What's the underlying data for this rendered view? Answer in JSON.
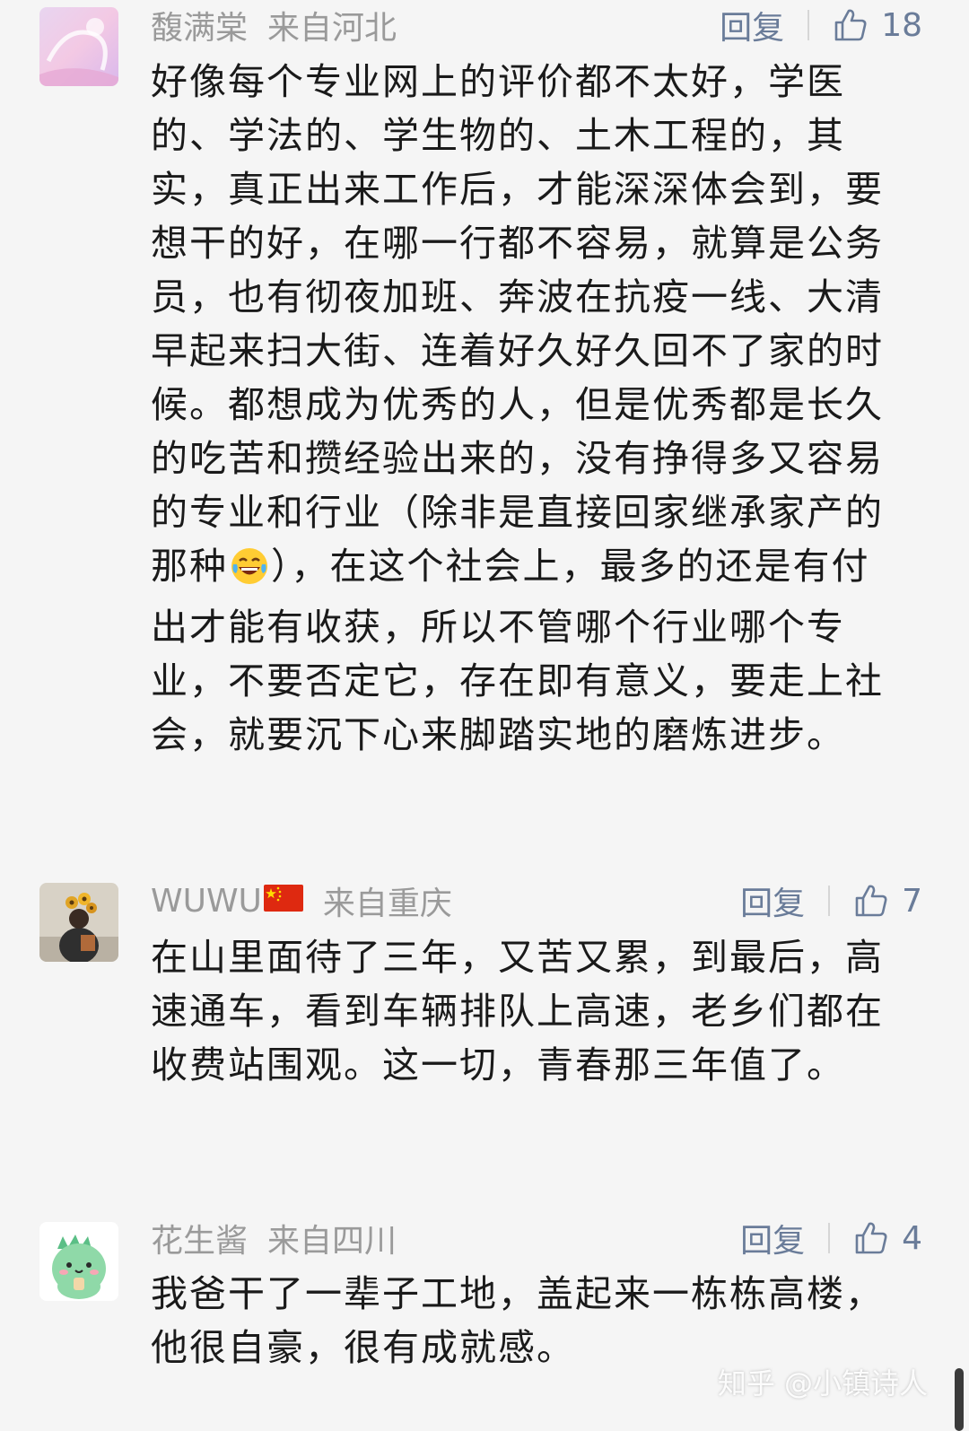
{
  "comments": [
    {
      "username": "馥满棠",
      "location": "来自河北",
      "reply_label": "回复",
      "likes": "18",
      "text_before_emoji": "好像每个专业网上的评价都不太好，学医的、学法的、学生物的、土木工程的，其实，真正出来工作后，才能深深体会到，要想干的好，在哪一行都不容易，就算是公务员，也有彻夜加班、奔波在抗疫一线、大清早起来扫大街、连着好久好久回不了家的时候。都想成为优秀的人，但是优秀都是长久的吃苦和攒经验出来的，没有挣得多又容易的专业和行业（除非是直接回家继承家产的那种",
      "emoji_icon": "laughing-tears-emoji",
      "text_after_emoji": "），在这个社会上，最多的还是有付出才能有收获，所以不管哪个行业哪个专业，不要否定它，存在即有意义，要走上社会，就要沉下心来脚踏实地的磨炼进步。"
    },
    {
      "username": "WUWU",
      "flag_icon": "china-flag-icon",
      "location": "来自重庆",
      "reply_label": "回复",
      "likes": "7",
      "text": "在山里面待了三年，又苦又累，到最后，高速通车，看到车辆排队上高速，老乡们都在收费站围观。这一切，青春那三年值了。"
    },
    {
      "username": "花生酱",
      "location": "来自四川",
      "reply_label": "回复",
      "likes": "4",
      "text": "我爸干了一辈子工地，盖起来一栋栋高楼，他很自豪，很有成就感。"
    }
  ],
  "watermark": "知乎 @小镇诗人",
  "colors": {
    "background": "#f5f5f5",
    "meta_text": "#9a9a9a",
    "action_text": "#6a7c99",
    "body_text": "#1a1a1a"
  }
}
